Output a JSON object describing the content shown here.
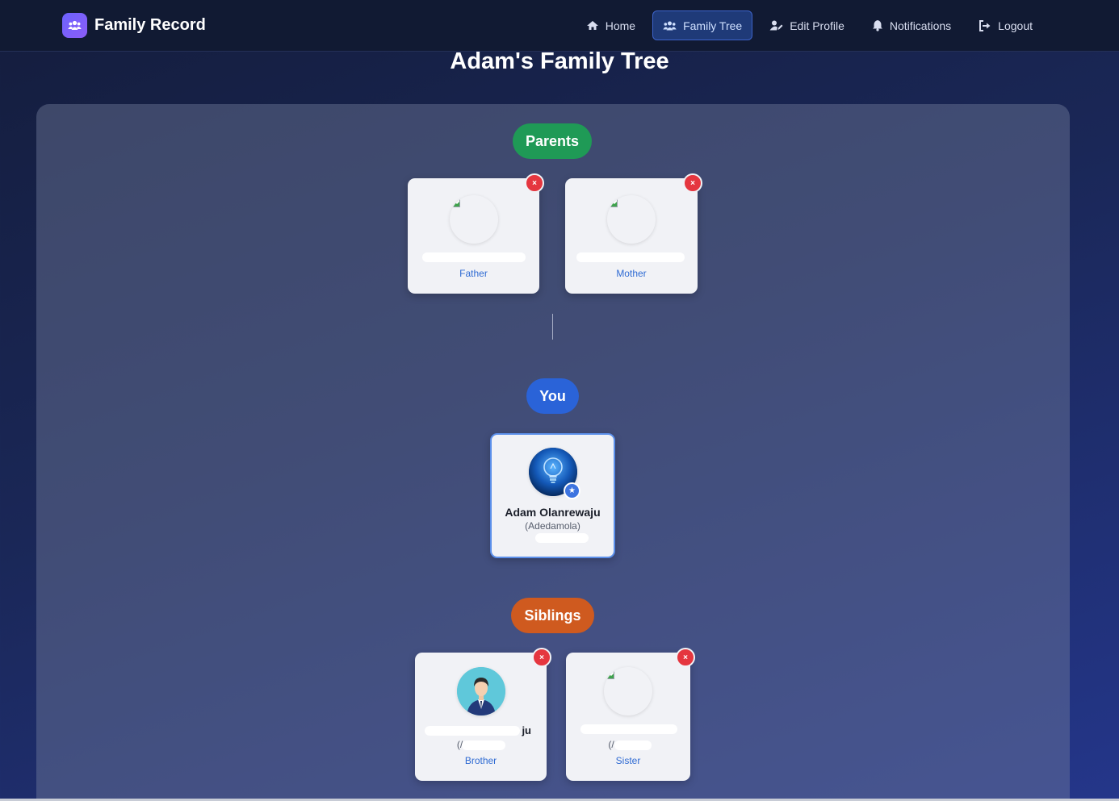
{
  "brand": {
    "title": "Family Record",
    "icon": "users-icon",
    "accent": "#7b5cf6"
  },
  "nav": {
    "items": [
      {
        "label": "Home",
        "icon": "home-icon"
      },
      {
        "label": "Family Tree",
        "icon": "users-icon",
        "active": true
      },
      {
        "label": "Edit Profile",
        "icon": "user-edit-icon"
      },
      {
        "label": "Notifications",
        "icon": "bell-icon"
      },
      {
        "label": "Logout",
        "icon": "logout-icon"
      }
    ]
  },
  "page": {
    "title": "Adam's Family Tree"
  },
  "sections": {
    "parents": {
      "label": "Parents",
      "color": "#1f9a56"
    },
    "you": {
      "label": "You",
      "color": "#2a63d8"
    },
    "siblings": {
      "label": "Siblings",
      "color": "#cf5a1f"
    }
  },
  "parents": [
    {
      "relation": "Father",
      "image_alt": "Parent image"
    },
    {
      "relation": "Mother",
      "image_alt": "Parent image"
    }
  ],
  "you": {
    "name": "Adam Olanrewaju",
    "nickname": "(Adedamola)",
    "badge": "star-icon"
  },
  "siblings": [
    {
      "name_suffix": "ju",
      "nickname_prefix": "(/",
      "relation": "Brother"
    },
    {
      "nickname_prefix": "(/",
      "relation": "Sister",
      "image_alt": "Sibling image"
    }
  ],
  "remove_label": "×"
}
